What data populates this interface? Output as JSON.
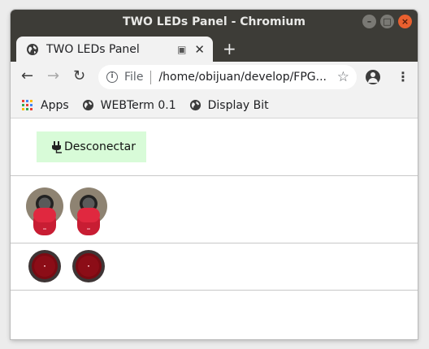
{
  "window": {
    "title": "TWO LEDs Panel - Chromium"
  },
  "tab": {
    "title": "TWO LEDs Panel"
  },
  "address": {
    "scheme": "File",
    "url": "/home/obijuan/develop/FPG..."
  },
  "bookmarks": [
    {
      "label": "Apps",
      "icon": "apps-grid-icon"
    },
    {
      "label": "WEBTerm 0.1",
      "icon": "globe-icon"
    },
    {
      "label": "Display Bit",
      "icon": "globe-icon"
    }
  ],
  "panel": {
    "connect_button": "Desconectar",
    "switches": [
      {
        "state": "down"
      },
      {
        "state": "down"
      }
    ],
    "leds": [
      {
        "state": "off"
      },
      {
        "state": "off"
      }
    ]
  },
  "colors": {
    "titlebar": "#3d3c37",
    "connect_bg": "#d8fbd8",
    "switch_red": "#d8253a",
    "led_off": "#7a0a12"
  }
}
